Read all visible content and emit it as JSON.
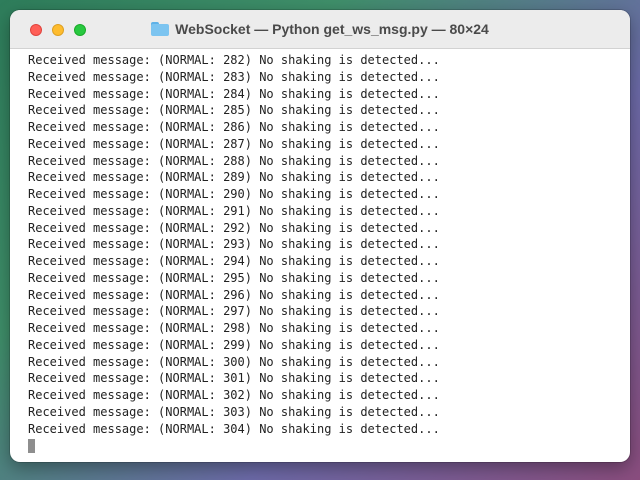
{
  "window": {
    "title": "WebSocket — Python get_ws_msg.py — 80×24",
    "colors": {
      "close": "#ff5f57",
      "minimize": "#febc2e",
      "maximize": "#28c840"
    }
  },
  "terminal": {
    "lines": [
      "Received message: (NORMAL: 282) No shaking is detected...",
      "Received message: (NORMAL: 283) No shaking is detected...",
      "Received message: (NORMAL: 284) No shaking is detected...",
      "Received message: (NORMAL: 285) No shaking is detected...",
      "Received message: (NORMAL: 286) No shaking is detected...",
      "Received message: (NORMAL: 287) No shaking is detected...",
      "Received message: (NORMAL: 288) No shaking is detected...",
      "Received message: (NORMAL: 289) No shaking is detected...",
      "Received message: (NORMAL: 290) No shaking is detected...",
      "Received message: (NORMAL: 291) No shaking is detected...",
      "Received message: (NORMAL: 292) No shaking is detected...",
      "Received message: (NORMAL: 293) No shaking is detected...",
      "Received message: (NORMAL: 294) No shaking is detected...",
      "Received message: (NORMAL: 295) No shaking is detected...",
      "Received message: (NORMAL: 296) No shaking is detected...",
      "Received message: (NORMAL: 297) No shaking is detected...",
      "Received message: (NORMAL: 298) No shaking is detected...",
      "Received message: (NORMAL: 299) No shaking is detected...",
      "Received message: (NORMAL: 300) No shaking is detected...",
      "Received message: (NORMAL: 301) No shaking is detected...",
      "Received message: (NORMAL: 302) No shaking is detected...",
      "Received message: (NORMAL: 303) No shaking is detected...",
      "Received message: (NORMAL: 304) No shaking is detected..."
    ]
  },
  "icons": {
    "title": "folder-icon",
    "cursor": "terminal-cursor"
  }
}
